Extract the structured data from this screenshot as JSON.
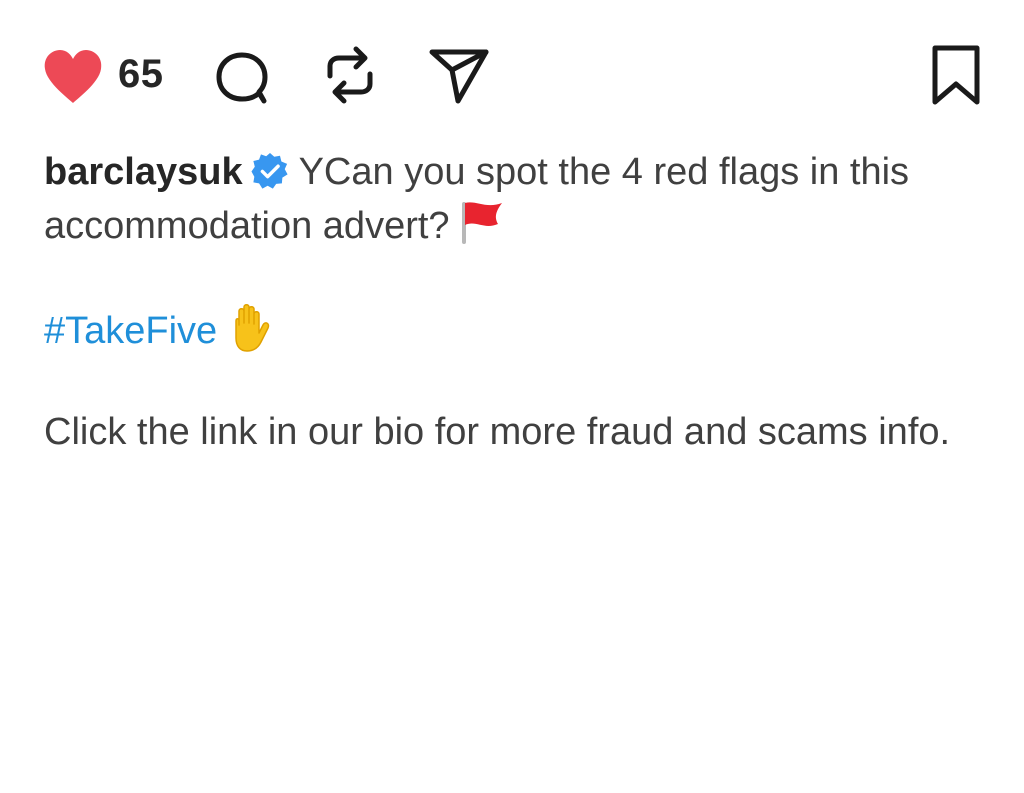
{
  "post_actions": {
    "like_count": "65",
    "icons": {
      "like": "heart-icon",
      "comment": "comment-icon",
      "repost": "repost-icon",
      "share": "send-icon",
      "save": "bookmark-icon"
    },
    "liked": true,
    "like_color": "#ed4956"
  },
  "caption": {
    "username": "barclaysuk",
    "verified": true,
    "verified_badge_color": "#3897f0",
    "text": "YCan you spot the 4 red flags in this accommodation advert?",
    "text_emoji": "red-flag-emoji",
    "hashtag": "#TakeFive",
    "hashtag_emoji": "raised-hand-emoji",
    "hashtag_color": "#1f8fd9",
    "footer": "Click the link in our bio for more fraud and scams info."
  }
}
